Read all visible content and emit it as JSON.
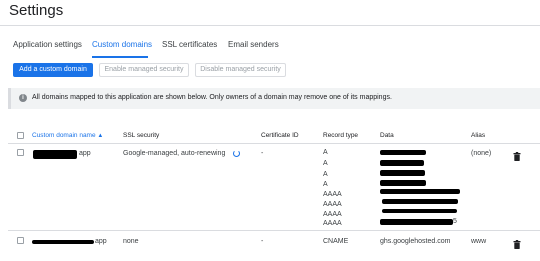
{
  "page": {
    "title": "Settings"
  },
  "tabs": [
    {
      "label": "Application settings"
    },
    {
      "label": "Custom domains"
    },
    {
      "label": "SSL certificates"
    },
    {
      "label": "Email senders"
    }
  ],
  "toolbar": {
    "add_label": "Add a custom domain",
    "enable_label": "Enable managed security",
    "disable_label": "Disable managed security"
  },
  "notice": {
    "text": "All domains mapped to this application are shown below. Only owners of a domain may remove one of its mappings."
  },
  "table": {
    "columns": {
      "domain": "Custom domain name",
      "ssl": "SSL security",
      "cert": "Certificate ID",
      "record": "Record type",
      "data": "Data",
      "alias": "Alias"
    },
    "rows": [
      {
        "domain": "app",
        "ssl": "Google-managed, auto-renewing",
        "cert": "-",
        "records": [
          "A",
          "A",
          "A",
          "A",
          "AAAA",
          "AAAA",
          "AAAA",
          "AAAA"
        ],
        "data_tail": "5",
        "alias": "(none)"
      },
      {
        "domain": "app",
        "ssl": "none",
        "cert": "-",
        "records": [
          "CNAME"
        ],
        "data": "ghs.googlehosted.com",
        "alias": "www"
      }
    ]
  },
  "colors": {
    "accent": "#1a73e8",
    "text": "#202124",
    "border": "#dadce0"
  }
}
